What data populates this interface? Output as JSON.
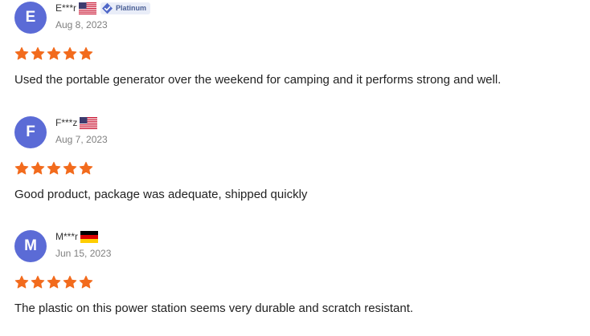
{
  "colors": {
    "avatar_bg": "#5b6bd6",
    "star": "#f26b1d",
    "badge_bg": "#e9edf8",
    "badge_text": "#4a5f96",
    "date_text": "#808080"
  },
  "reviews": [
    {
      "avatar_letter": "E",
      "user": "E***r",
      "flag_icon": "us-flag-icon",
      "badge": {
        "icon": "diamond-check-icon",
        "label": "Platinum"
      },
      "date": "Aug 8, 2023",
      "rating": 5,
      "text": "Used the portable generator over the weekend for camping and it performs strong and well."
    },
    {
      "avatar_letter": "F",
      "user": "F***z",
      "flag_icon": "us-flag-icon",
      "date": "Aug 7, 2023",
      "rating": 5,
      "text": "Good product, package was adequate, shipped quickly"
    },
    {
      "avatar_letter": "M",
      "user": "M***r",
      "flag_icon": "de-flag-icon",
      "date": "Jun 15, 2023",
      "rating": 5,
      "text": "The plastic on this power station seems very durable and scratch resistant."
    }
  ]
}
